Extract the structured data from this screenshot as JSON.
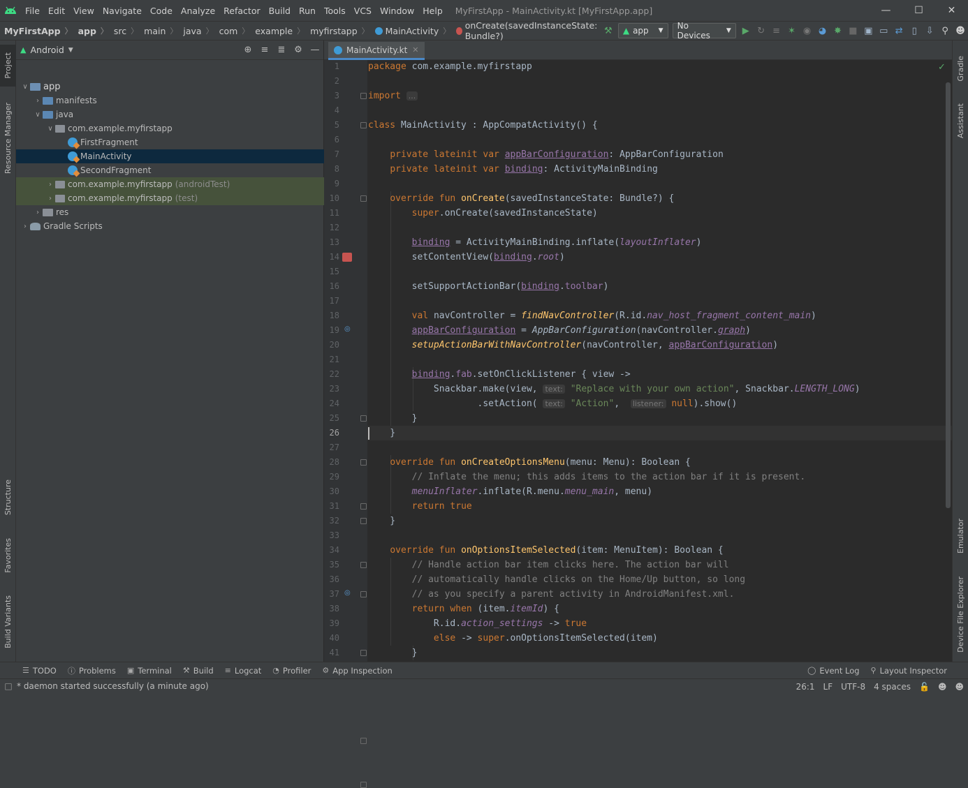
{
  "title_bar": {
    "menu": [
      "File",
      "Edit",
      "View",
      "Navigate",
      "Code",
      "Analyze",
      "Refactor",
      "Build",
      "Run",
      "Tools",
      "VCS",
      "Window",
      "Help"
    ],
    "window_title": "MyFirstApp - MainActivity.kt [MyFirstApp.app]"
  },
  "nav_bar": {
    "breadcrumbs": [
      "MyFirstApp",
      "app",
      "src",
      "main",
      "java",
      "com",
      "example",
      "myfirstapp",
      "MainActivity",
      "onCreate(savedInstanceState: Bundle?)"
    ],
    "run_config": "app",
    "device": "No Devices"
  },
  "left_stripe": {
    "tabs": [
      "Project",
      "Resource Manager",
      "Structure",
      "Favorites",
      "Build Variants"
    ]
  },
  "right_stripe": {
    "tabs": [
      "Gradle",
      "Assistant",
      "Emulator",
      "Device File Explorer"
    ]
  },
  "project": {
    "view": "Android",
    "tree": [
      {
        "label": "app",
        "indent": 0,
        "arrow": "v",
        "icon": "module",
        "bold": true
      },
      {
        "label": "manifests",
        "indent": 1,
        "arrow": ">",
        "icon": "folder"
      },
      {
        "label": "java",
        "indent": 1,
        "arrow": "v",
        "icon": "folder"
      },
      {
        "label": "com.example.myfirstapp",
        "indent": 2,
        "arrow": "v",
        "icon": "package"
      },
      {
        "label": "FirstFragment",
        "indent": 3,
        "arrow": "",
        "icon": "kotlin"
      },
      {
        "label": "MainActivity",
        "indent": 3,
        "arrow": "",
        "icon": "kotlin",
        "state": "selected"
      },
      {
        "label": "SecondFragment",
        "indent": 3,
        "arrow": "",
        "icon": "kotlin"
      },
      {
        "label": "com.example.myfirstapp",
        "suffix": "(androidTest)",
        "indent": 2,
        "arrow": ">",
        "icon": "package",
        "state": "highlight"
      },
      {
        "label": "com.example.myfirstapp",
        "suffix": "(test)",
        "indent": 2,
        "arrow": ">",
        "icon": "package",
        "state": "highlight"
      },
      {
        "label": "res",
        "indent": 1,
        "arrow": ">",
        "icon": "res"
      },
      {
        "label": "Gradle Scripts",
        "indent": 0,
        "arrow": ">",
        "icon": "gradle"
      }
    ]
  },
  "editor": {
    "tab": "MainActivity.kt",
    "current_line": 26,
    "lines": [
      [
        [
          "kw",
          "package "
        ],
        [
          "",
          "com.example.myfirstapp"
        ]
      ],
      [],
      [
        [
          "kw",
          "import "
        ],
        [
          "hint",
          "..."
        ]
      ],
      [],
      [
        [
          "kw",
          "class "
        ],
        [
          "",
          "MainActivity : AppCompatActivity() {"
        ]
      ],
      [],
      [
        [
          "",
          "    "
        ],
        [
          "kw",
          "private lateinit var "
        ],
        [
          "prop ul",
          "appBarConfiguration"
        ],
        [
          "",
          ": AppBarConfiguration"
        ]
      ],
      [
        [
          "",
          "    "
        ],
        [
          "kw",
          "private lateinit var "
        ],
        [
          "prop ul",
          "binding"
        ],
        [
          "",
          ": ActivityMainBinding"
        ]
      ],
      [],
      [
        [
          "",
          "    "
        ],
        [
          "kw",
          "override fun "
        ],
        [
          "fn",
          "onCreate"
        ],
        [
          "",
          "(savedInstanceState: Bundle?) {"
        ]
      ],
      [
        [
          "",
          "        "
        ],
        [
          "kw",
          "super"
        ],
        [
          "",
          ".onCreate(savedInstanceState)"
        ]
      ],
      [],
      [
        [
          "",
          "        "
        ],
        [
          "prop ul",
          "binding"
        ],
        [
          "",
          " = ActivityMainBinding.inflate("
        ],
        [
          "prop it",
          "layoutInflater"
        ],
        [
          "",
          ")"
        ]
      ],
      [
        [
          "",
          "        setContentView("
        ],
        [
          "prop ul",
          "binding"
        ],
        [
          "",
          "."
        ],
        [
          "prop it",
          "root"
        ],
        [
          "",
          ")"
        ]
      ],
      [],
      [
        [
          "",
          "        setSupportActionBar("
        ],
        [
          "prop ul",
          "binding"
        ],
        [
          "",
          "."
        ],
        [
          "prop",
          "toolbar"
        ],
        [
          "",
          ")"
        ]
      ],
      [],
      [
        [
          "",
          "        "
        ],
        [
          "kw",
          "val "
        ],
        [
          "",
          "navController = "
        ],
        [
          "fn it",
          "findNavController"
        ],
        [
          "",
          "(R.id."
        ],
        [
          "prop it",
          "nav_host_fragment_content_main"
        ],
        [
          "",
          ")"
        ]
      ],
      [
        [
          "",
          "        "
        ],
        [
          "prop ul",
          "appBarConfiguration"
        ],
        [
          "",
          " = "
        ],
        [
          "it",
          "AppBarConfiguration"
        ],
        [
          "",
          "(navController."
        ],
        [
          "prop ul it",
          "graph"
        ],
        [
          "",
          ")"
        ]
      ],
      [
        [
          "",
          "        "
        ],
        [
          "fn it",
          "setupActionBarWithNavController"
        ],
        [
          "",
          "(navController, "
        ],
        [
          "prop ul",
          "appBarConfiguration"
        ],
        [
          "",
          ")"
        ]
      ],
      [],
      [
        [
          "",
          "        "
        ],
        [
          "prop ul",
          "binding"
        ],
        [
          "",
          "."
        ],
        [
          "prop",
          "fab"
        ],
        [
          "",
          ".setOnClickListener { view ->"
        ]
      ],
      [
        [
          "",
          "            Snackbar.make(view, "
        ],
        [
          "hint",
          "text:"
        ],
        [
          "str",
          " \"Replace with your own action\""
        ],
        [
          "",
          ", Snackbar."
        ],
        [
          "prop it",
          "LENGTH_LONG"
        ],
        [
          "",
          ")"
        ]
      ],
      [
        [
          "",
          "                    .setAction( "
        ],
        [
          "hint",
          "text:"
        ],
        [
          "str",
          " \"Action\""
        ],
        [
          "",
          ",  "
        ],
        [
          "hint",
          "listener:"
        ],
        [
          "kw",
          " null"
        ],
        [
          "",
          ").show()"
        ]
      ],
      [
        [
          "",
          "        }"
        ]
      ],
      [
        [
          "",
          "    }"
        ]
      ],
      [],
      [
        [
          "",
          "    "
        ],
        [
          "kw",
          "override fun "
        ],
        [
          "fn",
          "onCreateOptionsMenu"
        ],
        [
          "",
          "(menu: Menu): Boolean {"
        ]
      ],
      [
        [
          "",
          "        "
        ],
        [
          "cm",
          "// Inflate the menu; this adds items to the action bar if it is present."
        ]
      ],
      [
        [
          "",
          "        "
        ],
        [
          "prop it",
          "menuInflater"
        ],
        [
          "",
          ".inflate(R.menu."
        ],
        [
          "prop it",
          "menu_main"
        ],
        [
          "",
          ", menu)"
        ]
      ],
      [
        [
          "",
          "        "
        ],
        [
          "kw",
          "return true"
        ]
      ],
      [
        [
          "",
          "    }"
        ]
      ],
      [],
      [
        [
          "",
          "    "
        ],
        [
          "kw",
          "override fun "
        ],
        [
          "fn",
          "onOptionsItemSelected"
        ],
        [
          "",
          "(item: MenuItem): Boolean {"
        ]
      ],
      [
        [
          "",
          "        "
        ],
        [
          "cm",
          "// Handle action bar item clicks here. The action bar will"
        ]
      ],
      [
        [
          "",
          "        "
        ],
        [
          "cm",
          "// automatically handle clicks on the Home/Up button, so long"
        ]
      ],
      [
        [
          "",
          "        "
        ],
        [
          "cm",
          "// as you specify a parent activity in AndroidManifest.xml."
        ]
      ],
      [
        [
          "",
          "        "
        ],
        [
          "kw",
          "return when "
        ],
        [
          "",
          "(item."
        ],
        [
          "prop it",
          "itemId"
        ],
        [
          "",
          ") {"
        ]
      ],
      [
        [
          "",
          "            R.id."
        ],
        [
          "prop it",
          "action_settings"
        ],
        [
          "",
          " -> "
        ],
        [
          "kw",
          "true"
        ]
      ],
      [
        [
          "",
          "            "
        ],
        [
          "kw",
          "else "
        ],
        [
          "",
          "-> "
        ],
        [
          "kw",
          "super"
        ],
        [
          "",
          ".onOptionsItemSelected(item)"
        ]
      ],
      [
        [
          "",
          "        }"
        ]
      ]
    ]
  },
  "bottom_tabs": [
    "TODO",
    "Problems",
    "Terminal",
    "Build",
    "Logcat",
    "Profiler",
    "App Inspection"
  ],
  "bottom_right_tabs": [
    "Event Log",
    "Layout Inspector"
  ],
  "status": {
    "message": "* daemon started successfully (a minute ago)",
    "position": "26:1",
    "line_sep": "LF",
    "encoding": "UTF-8",
    "indent": "4 spaces"
  }
}
